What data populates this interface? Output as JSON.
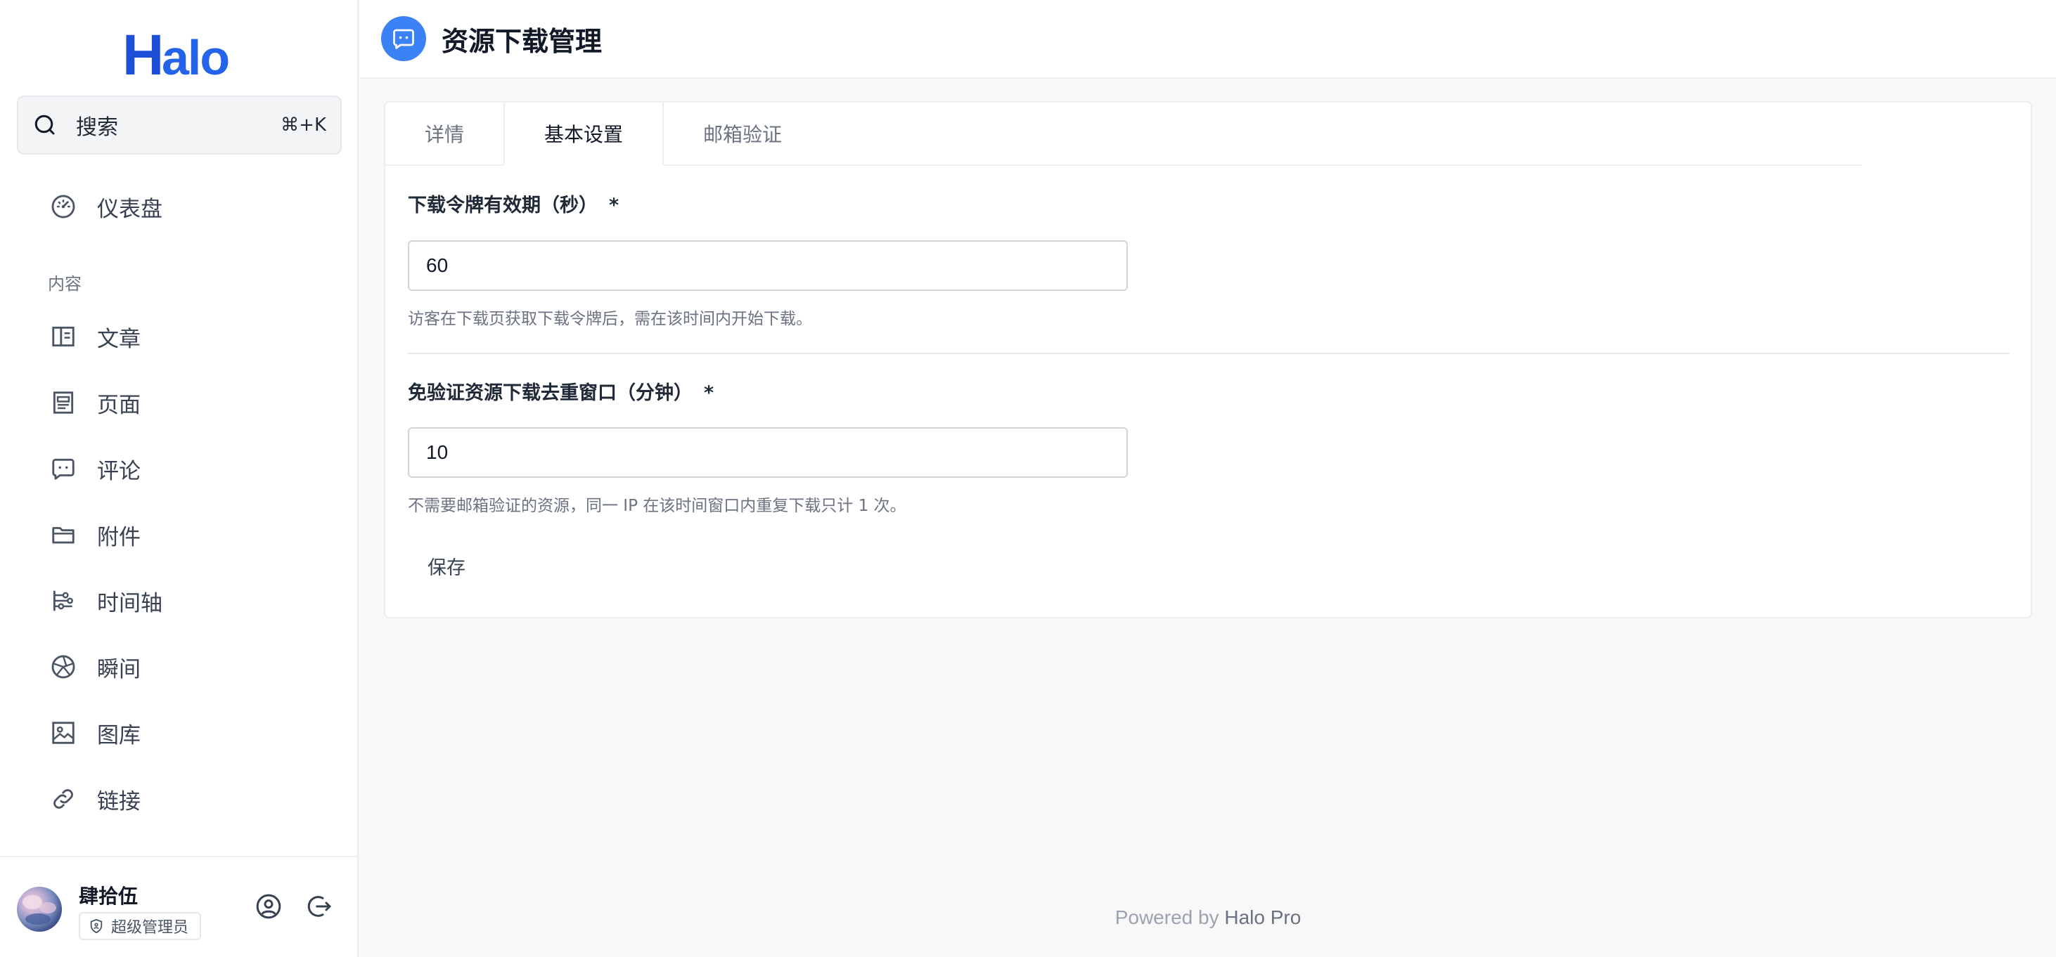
{
  "sidebar": {
    "logo_text": "Halo",
    "search": {
      "label": "搜索",
      "shortcut": "⌘+K"
    },
    "dashboard": {
      "label": "仪表盘",
      "icon": "dashboard-icon"
    },
    "section_content": "内容",
    "items": [
      {
        "label": "文章",
        "icon": "post-icon"
      },
      {
        "label": "页面",
        "icon": "page-icon"
      },
      {
        "label": "评论",
        "icon": "comment-icon"
      },
      {
        "label": "附件",
        "icon": "folder-icon"
      },
      {
        "label": "时间轴",
        "icon": "timeline-icon"
      },
      {
        "label": "瞬间",
        "icon": "aperture-icon"
      },
      {
        "label": "图库",
        "icon": "image-icon"
      },
      {
        "label": "链接",
        "icon": "link-icon"
      }
    ]
  },
  "user": {
    "name": "肆拾伍",
    "role": "超级管理员"
  },
  "header": {
    "title": "资源下载管理",
    "accent": "#3b82f6"
  },
  "tabs": [
    {
      "label": "详情",
      "active": false
    },
    {
      "label": "基本设置",
      "active": true
    },
    {
      "label": "邮箱验证",
      "active": false
    }
  ],
  "form": {
    "token_ttl": {
      "label": "下载令牌有效期（秒）",
      "required_mark": "*",
      "value": "60",
      "help": "访客在下载页获取下载令牌后，需在该时间内开始下载。"
    },
    "dedupe_window": {
      "label": "免验证资源下载去重窗口（分钟）",
      "required_mark": "*",
      "value": "10",
      "help": "不需要邮箱验证的资源，同一 IP 在该时间窗口内重复下载只计 1 次。"
    },
    "save_label": "保存"
  },
  "footer": {
    "prefix": "Powered by ",
    "brand": "Halo Pro"
  }
}
